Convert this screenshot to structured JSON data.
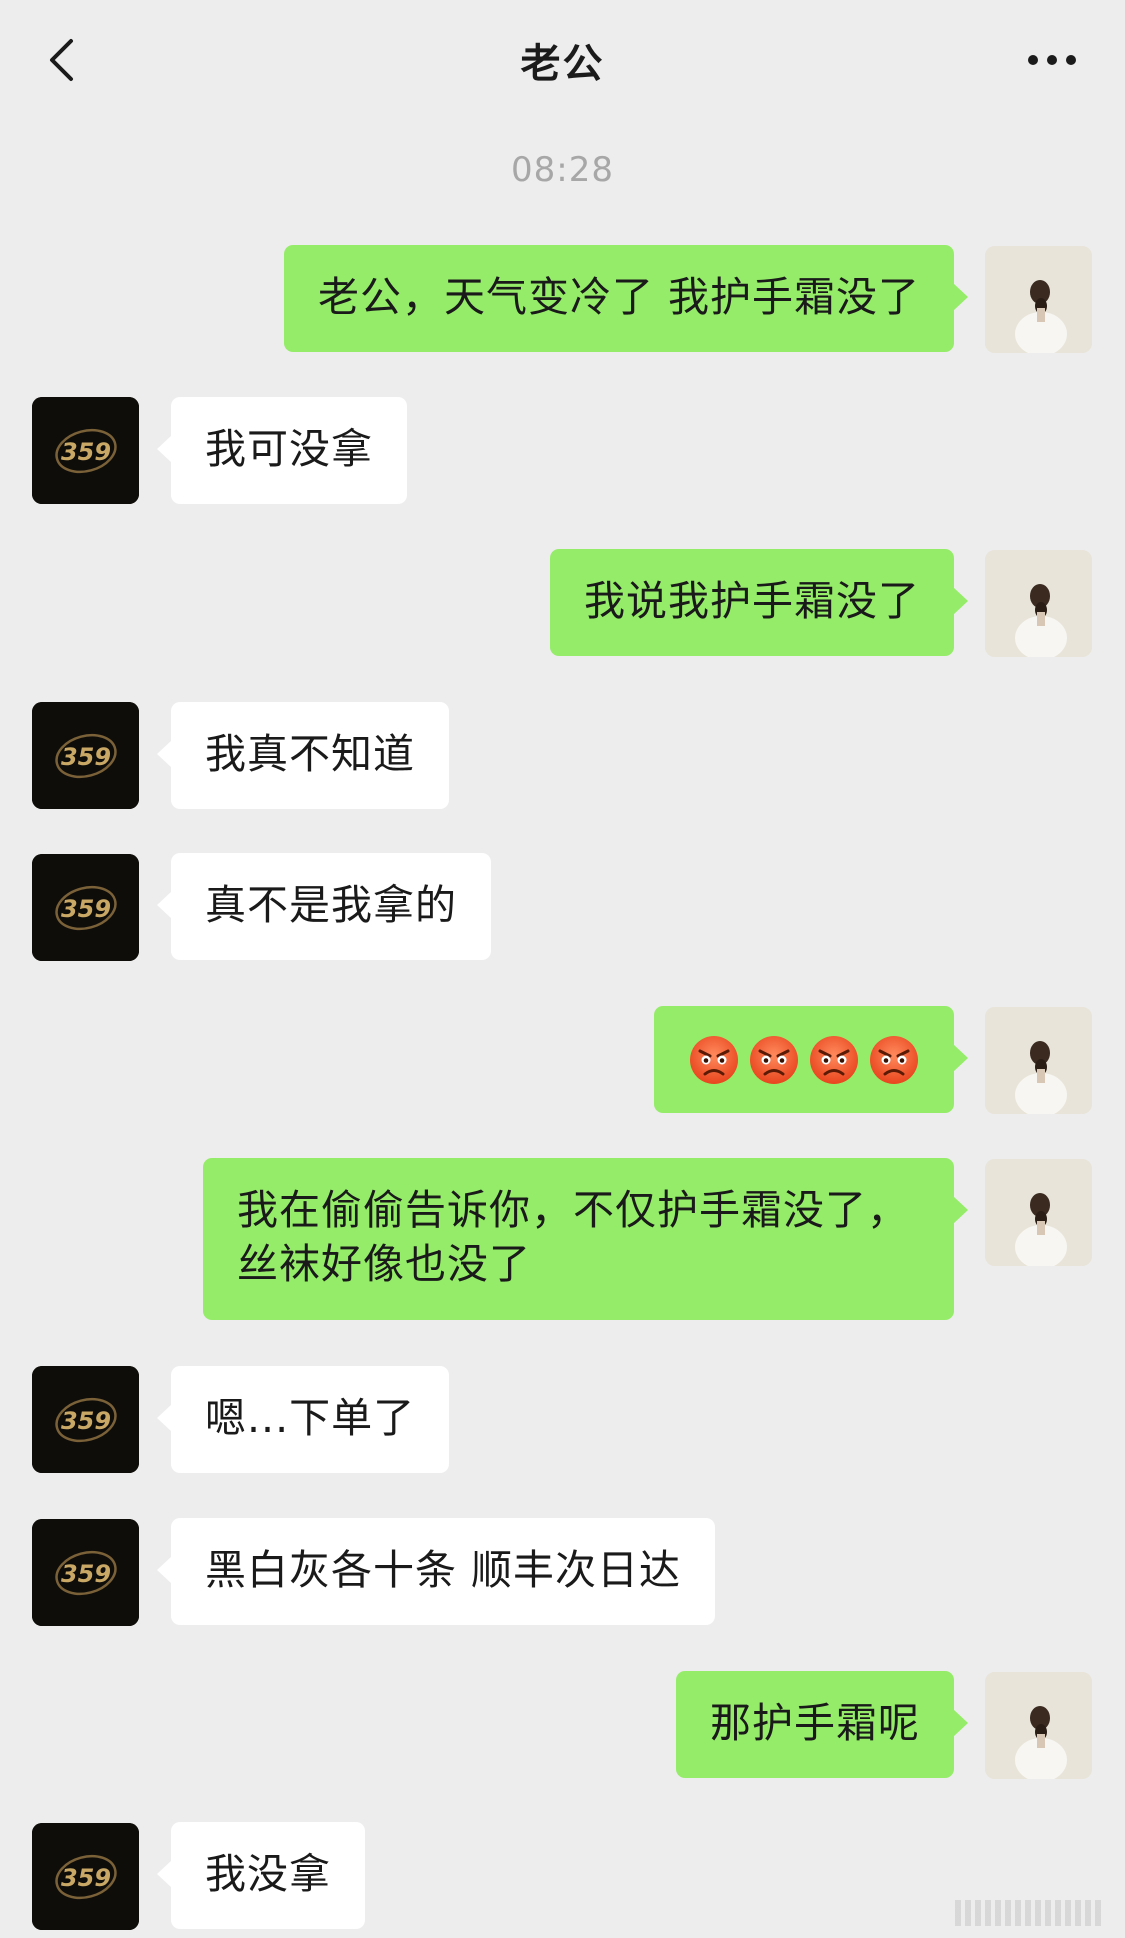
{
  "header": {
    "title": "老公"
  },
  "timestamp": "08:28",
  "icons": {
    "back": "chevron-left-icon",
    "more": "more-dots-icon",
    "emoji": "angry-face-icon"
  },
  "contact_avatar_text": "359",
  "colors": {
    "background": "#ededed",
    "sent_bubble": "#95ec69",
    "received_bubble": "#ffffff"
  },
  "messages": [
    {
      "from": "me",
      "text": "老公，天气变冷了 我护手霜没了"
    },
    {
      "from": "him",
      "text": "我可没拿"
    },
    {
      "from": "me",
      "text": "我说我护手霜没了"
    },
    {
      "from": "him",
      "text": "我真不知道"
    },
    {
      "from": "him",
      "text": "真不是我拿的"
    },
    {
      "from": "me",
      "emoji": "angry-face",
      "emoji_count": 4
    },
    {
      "from": "me",
      "text_line1": "我在偷偷告诉你，不仅护手霜没了，",
      "text_line2": "丝袜好像也没了"
    },
    {
      "from": "him",
      "text": "嗯...下单了"
    },
    {
      "from": "him",
      "text": "黑白灰各十条 顺丰次日达"
    },
    {
      "from": "me",
      "text": "那护手霜呢"
    },
    {
      "from": "him",
      "text": "我没拿"
    }
  ]
}
